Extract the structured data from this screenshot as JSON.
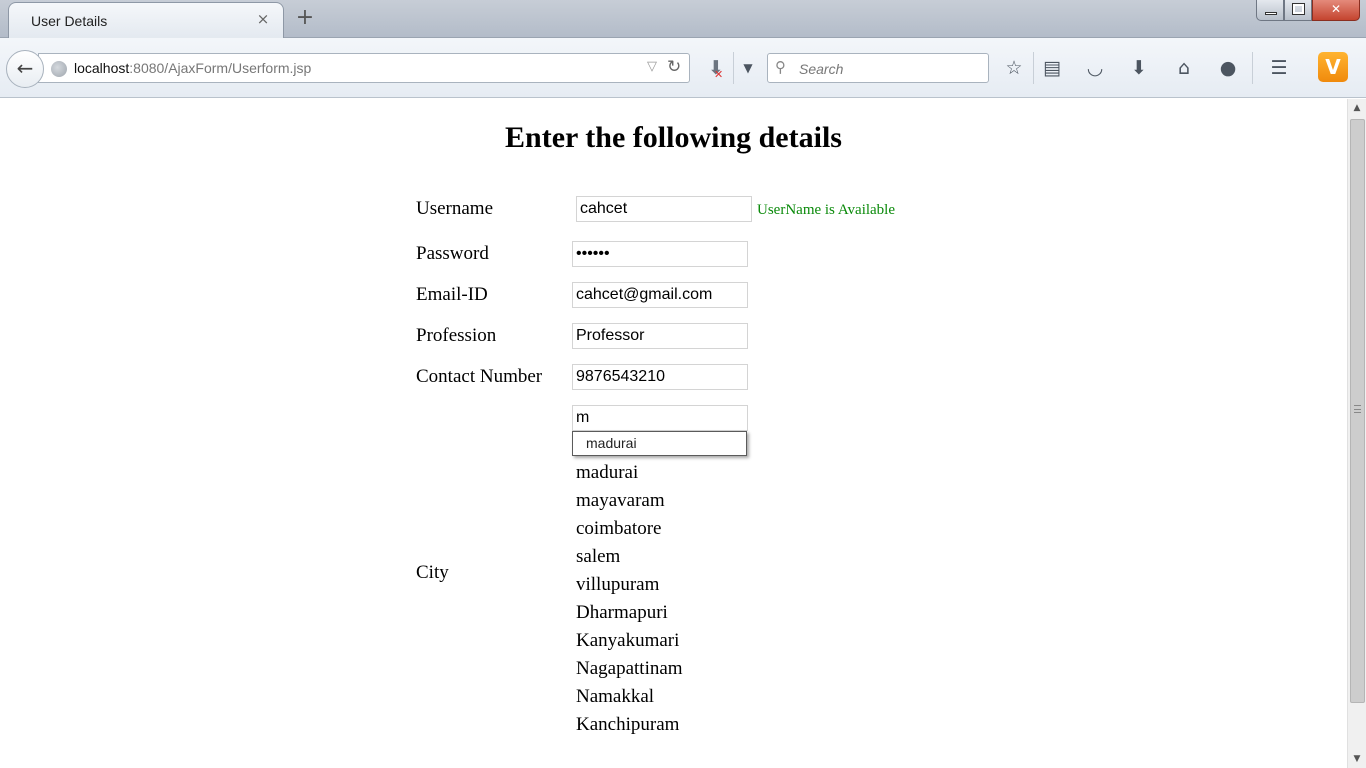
{
  "browser": {
    "tab_title": "User Details",
    "tab_close": "×",
    "new_tab": "+",
    "url_host": "localhost",
    "url_rest": ":8080/AjaxForm/Userform.jsp",
    "search_placeholder": "Search",
    "icons": [
      "back-arrow-icon",
      "globe-icon",
      "reload-icon",
      "addon-block-icon",
      "search-icon",
      "bookmark-star-icon",
      "reading-list-icon",
      "pocket-icon",
      "download-icon",
      "home-icon",
      "chat-icon",
      "menu-icon",
      "vivaldi-icon"
    ]
  },
  "form": {
    "heading": "Enter the following details",
    "username_label": "Username",
    "username_value": "cahcet",
    "username_status": "UserName is Available",
    "password_label": "Password",
    "password_value": "••••••",
    "email_label": "Email-ID",
    "email_value": "cahcet@gmail.com",
    "profession_label": "Profession",
    "profession_value": "Professor",
    "contact_label": "Contact Number",
    "contact_value": "9876543210",
    "city_label": "City",
    "city_value": "m",
    "autocomplete_suggestion": "madurai",
    "cities": [
      "madurai",
      "mayavaram",
      "coimbatore",
      "salem",
      "villupuram",
      "Dharmapuri",
      "Kanyakumari",
      "Nagapattinam",
      "Namakkal",
      "Kanchipuram"
    ]
  },
  "colors": {
    "status_available": "#0a8a0a",
    "vivaldi_accent": "#f59c1a"
  }
}
